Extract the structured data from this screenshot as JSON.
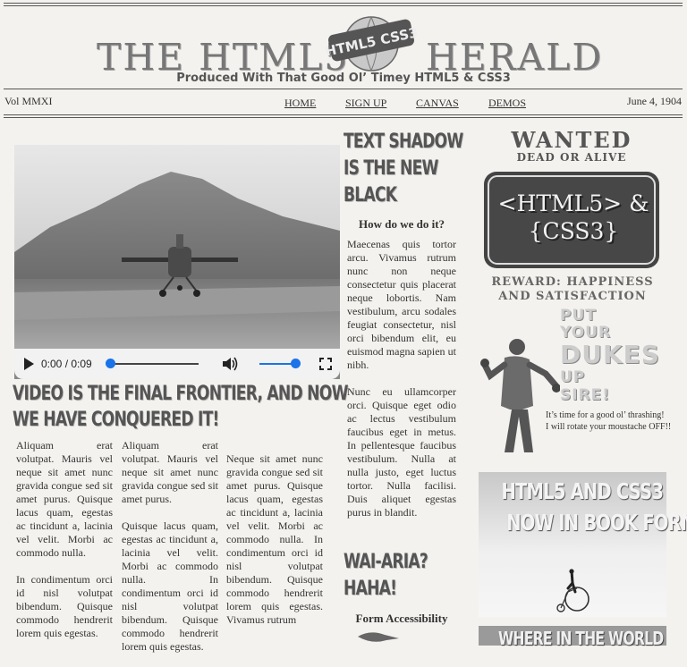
{
  "masthead": {
    "title_left": "THE HTML5",
    "title_right": "HERALD",
    "logo_text": "HTML5 CSS3",
    "tagline": "Produced With That Good Ol’ Timey HTML5 & CSS3",
    "volume": "Vol MMXI",
    "date": "June 4, 1904"
  },
  "nav": {
    "home": "HOME",
    "signup": "SIGN UP",
    "canvas": "CANVAS",
    "demos": "DEMOS"
  },
  "video": {
    "time": "0:00 / 0:09",
    "progress": 0,
    "volume_level": 1.0,
    "play_icon": "play-icon",
    "volume_icon": "speaker-icon",
    "fullscreen_icon": "fullscreen-icon"
  },
  "article_video": {
    "headline_line1": "VIDEO IS THE FINAL FRONTIER, AND NOW",
    "headline_line2": "WE HAVE CONQUERED IT!",
    "col1_p1": "Aliquam erat volutpat. Mauris vel neque sit amet nunc gravida congue sed sit amet purus. Quisque lacus quam, egestas ac tincidunt a, lacinia vel velit. Morbi ac commodo nulla.",
    "col1_p2": "In condimentum orci id nisl volutpat bibendum. Quisque commodo hendrerit lorem quis egestas.",
    "col2_p1": "Aliquam erat volutpat. Mauris vel neque sit amet nunc gravida congue sed sit amet purus.",
    "col2_p2": "Quisque lacus quam, egestas ac tincidunt a, lacinia vel velit. Morbi ac commodo nulla. In condimentum orci id nisl volutpat bibendum. Quisque commodo hendrerit lorem quis egestas.",
    "col3_p1": "Neque sit amet nunc gravida congue sed sit amet purus. Quisque lacus quam, egestas ac tincidunt a, lacinia vel velit. Morbi ac commodo nulla. In condimentum orci id nisl volutpat bibendum. Quisque commodo hendrerit lorem quis egestas. Vivamus rutrum"
  },
  "article_shadow": {
    "headline_line1": "TEXT SHADOW",
    "headline_line2": "IS THE NEW",
    "headline_line3": "BLACK",
    "subhead": "How do we do it?",
    "p1": "Maecenas quis tortor arcu. Vivamus rutrum nunc non neque consectetur quis placerat neque lobortis. Nam vestibulum, arcu sodales feugiat consectetur, nisl orci bibendum elit, eu euismod magna sapien ut nibh.",
    "p2": "Nunc eu ullamcorper orci. Quisque eget odio ac lectus vestibulum faucibus eget in metus. In pellentesque faucibus vestibulum. Nulla at nulla justo, eget luctus tortor. Nulla facilisi. Duis aliquet egestas purus in blandit."
  },
  "article_aria": {
    "headline_line1": "WAI-ARIA?",
    "headline_line2": "HAHA!",
    "subhead": "Form Accessibility"
  },
  "ad_wanted": {
    "wanted": "WANTED",
    "dead_or_alive": "DEAD OR ALIVE",
    "badge_line1": "<HTML5> &",
    "badge_line2": "{CSS3}",
    "reward_line1": "REWARD: HAPPINESS",
    "reward_line2": "AND SATISFACTION",
    "put": "PUT",
    "your": "YOUR",
    "dukes": "DUKES",
    "up": "UP",
    "sire": "SIRE!",
    "thrash_line1": "It’s time for a good ol’ thrashing!",
    "thrash_line2": "I will rotate your moustache OFF!!"
  },
  "ad_book": {
    "line1": "HTML5 AND CSS3",
    "line2": "NOW IN BOOK FORM!"
  },
  "ad_where": {
    "title": "WHERE IN THE WORLD"
  }
}
